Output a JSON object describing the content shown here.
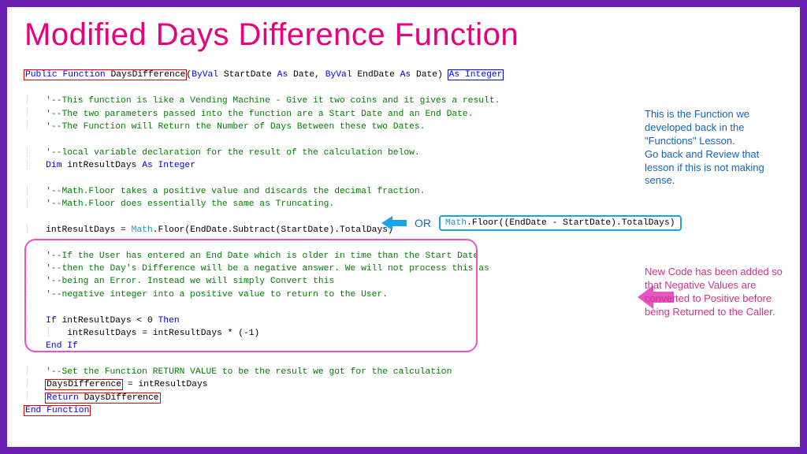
{
  "title": "Modified Days Difference Function",
  "code": {
    "sig_public_function": "Public Function",
    "sig_name": " DaysDifference",
    "sig_params": "(ByVal StartDate As Date, ByVal EndDate As Date)",
    "sig_as_integer": "As Integer",
    "sig_byval1": "ByVal",
    "sig_startdate": " StartDate ",
    "sig_as1": "As",
    "sig_date1": " Date",
    "sig_comma": ", ",
    "sig_byval2": "ByVal",
    "sig_enddate": " EndDate ",
    "sig_as2": "As",
    "sig_date2": " Date",
    "c1": "'--This function is like a Vending Machine - Give it two coins and it gives a result.",
    "c2": "'--The two parameters passed into the function are a Start Date and an End Date.",
    "c3": "'--The Function will Return the Number of Days Between these two Dates.",
    "c_local": "'--local variable declaration for the result of the calculation below.",
    "dim": "Dim",
    "dim_var": " intResultDays ",
    "dim_as": "As",
    "dim_type": " Integer",
    "c_math1": "'--Math.Floor takes a positive value and discards the decimal fraction.",
    "c_math2": "'--Math.Floor does essentially the same as Truncating.",
    "calc_lhs": "intResultDays = ",
    "calc_math": "Math",
    "calc_rest": ".Floor(EndDate.Subtract(StartDate).TotalDays)",
    "c_neg1": "'--If the User has entered an End Date which is older in time than the Start Date",
    "c_neg2": "'--then the Day's Difference will be a negative answer. We will not process this as",
    "c_neg3": "'--being an Error. Instead we will simply Convert this",
    "c_neg4": "'--negative integer into a positive value to return to the User.",
    "if_kw": "If",
    "if_cond": " intResultDays < 0 ",
    "then_kw": "Then",
    "if_body": "intResultDays = intResultDays * (-1)",
    "endif": "End If",
    "c_set": "'--Set the Function RETURN VALUE to be the result we got for the calculation",
    "assign_return": "DaysDifference",
    "assign_rest": " = intResultDays",
    "return_kw": "Return",
    "return_target": " DaysDifference",
    "end_function": "End Function"
  },
  "or_label": "OR",
  "alt_code_math": "Math",
  "alt_code_rest": ".Floor((EndDate - StartDate).TotalDays)",
  "annotation_top": "This is the Function we developed back in the \"Functions\" Lesson.\nGo back and Review that lesson if this is not making sense.",
  "annotation_mid": "New Code has been added so that Negative Values are converted to Positive before being Returned to the Caller.",
  "colors": {
    "accent_pink": "#e6007e",
    "accent_purple": "#6a1fb1",
    "link_blue": "#1565c0",
    "box_pink": "#e754c4"
  }
}
